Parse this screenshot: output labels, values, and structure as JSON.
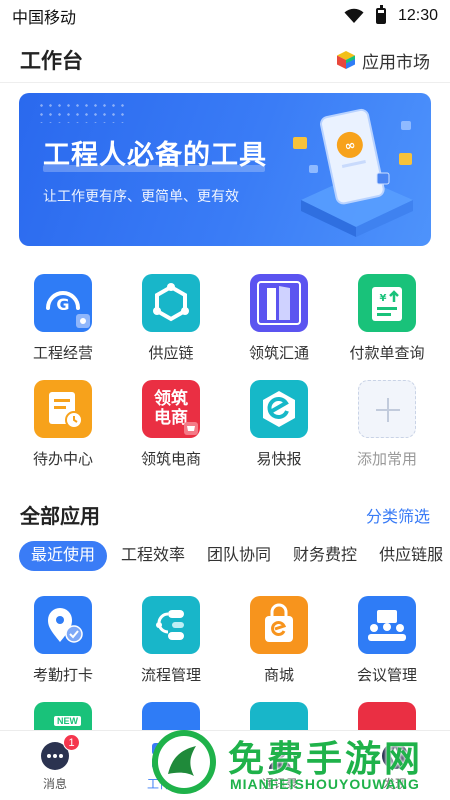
{
  "status": {
    "carrier": "中国移动",
    "time": "12:30"
  },
  "header": {
    "title": "工作台",
    "market_label": "应用市场"
  },
  "banner": {
    "title": "工程人必备的工具",
    "subtitle": "让工作更有序、更简单、更有效"
  },
  "quick_apps": [
    {
      "label": "工程经营",
      "color": "#2f7cf6"
    },
    {
      "label": "供应链",
      "color": "#18b6c9"
    },
    {
      "label": "领筑汇通",
      "color": "#5b54f0"
    },
    {
      "label": "付款单查询",
      "color": "#19c27a"
    },
    {
      "label": "待办中心",
      "color": "#f7a21b"
    },
    {
      "label": "领筑电商",
      "color": "#ea2f43",
      "icon_text_1": "领筑",
      "icon_text_2": "电商"
    },
    {
      "label": "易快报",
      "color": "#16b8c8"
    },
    {
      "label": "添加常用",
      "color": "#f2f5fb"
    }
  ],
  "all_apps": {
    "title": "全部应用",
    "filter_label": "分类筛选"
  },
  "tabs": [
    "最近使用",
    "工程效率",
    "团队协同",
    "财务费控",
    "供应链服"
  ],
  "apps": [
    {
      "label": "考勤打卡",
      "color": "#2f7cf6"
    },
    {
      "label": "流程管理",
      "color": "#18b6c9"
    },
    {
      "label": "商城",
      "color": "#f7941d"
    },
    {
      "label": "会议管理",
      "color": "#2f7cf6"
    }
  ],
  "partial_apps": [
    {
      "color": "#19c27a",
      "tag": "NEW"
    },
    {
      "color": "#2f7cf6"
    },
    {
      "color": "#18b6c9"
    },
    {
      "color": "#ea2f43"
    }
  ],
  "nav": [
    {
      "label": "消息",
      "badge": "1"
    },
    {
      "label": "工作台"
    },
    {
      "label": "通讯录"
    },
    {
      "label": "发现"
    }
  ],
  "watermark": {
    "text": "免费手游网",
    "sub": "MIANFEISHOUYOUWANG"
  }
}
